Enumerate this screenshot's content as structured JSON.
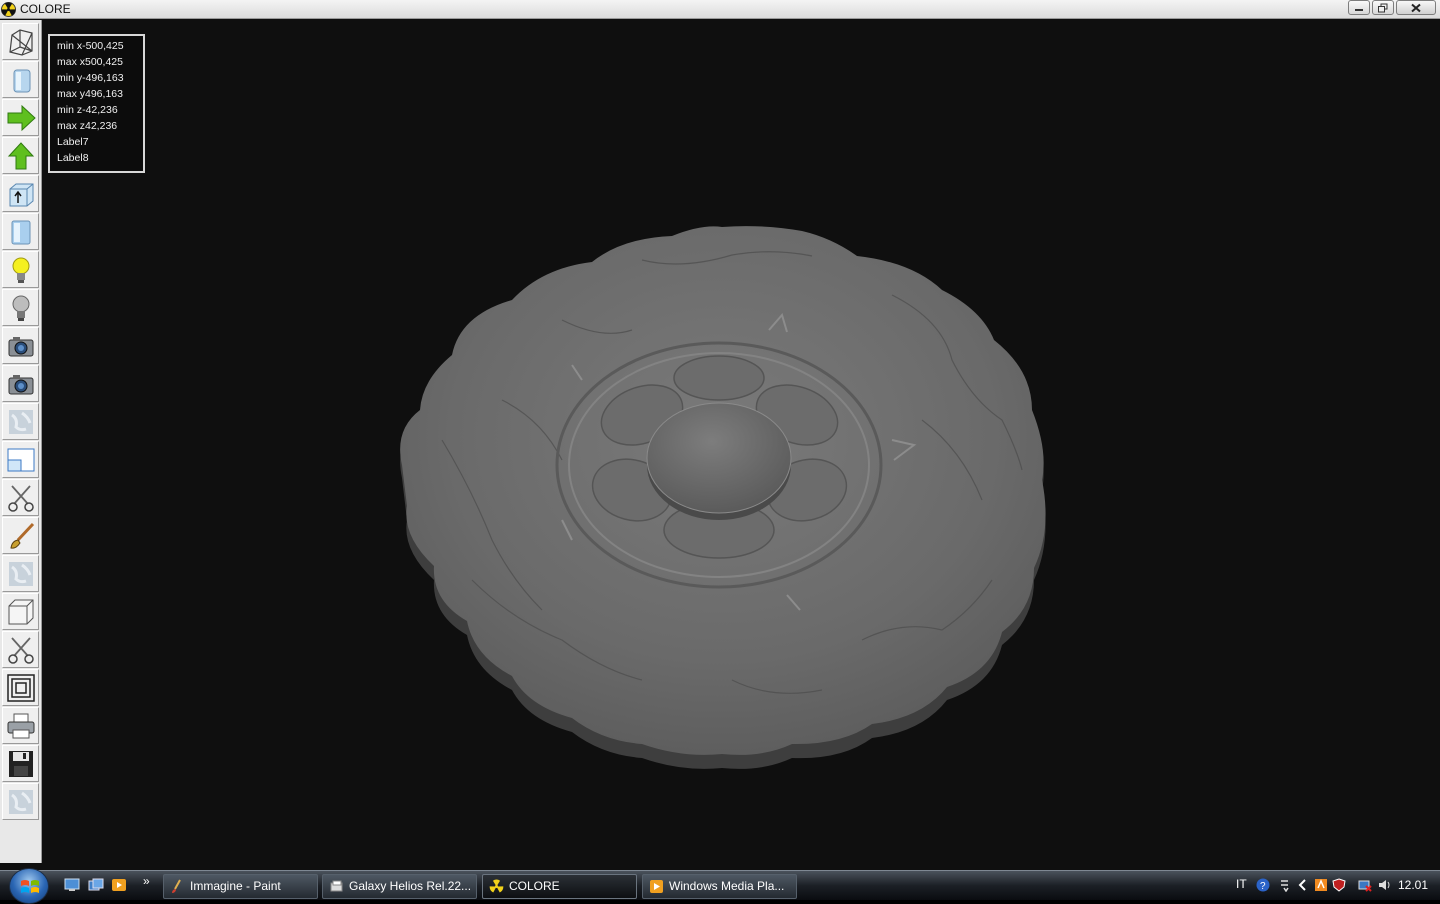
{
  "window": {
    "title": "COLORE",
    "controls": [
      "minimize",
      "restore",
      "close"
    ]
  },
  "toolbar": {
    "tools": [
      {
        "name": "wireframe-icon"
      },
      {
        "name": "solid-view-icon"
      },
      {
        "name": "arrow-right-icon"
      },
      {
        "name": "arrow-up-icon"
      },
      {
        "name": "box-arrow-icon"
      },
      {
        "name": "cylinder-icon"
      },
      {
        "name": "light-on-icon"
      },
      {
        "name": "light-off-icon"
      },
      {
        "name": "camera-icon"
      },
      {
        "name": "camera-icon"
      },
      {
        "name": "texture-icon"
      },
      {
        "name": "window-icon"
      },
      {
        "name": "scissors-icon"
      },
      {
        "name": "brush-icon"
      },
      {
        "name": "texture-icon"
      },
      {
        "name": "cube-icon"
      },
      {
        "name": "scissors-icon"
      },
      {
        "name": "concentric-squares-icon"
      },
      {
        "name": "printer-icon"
      },
      {
        "name": "save-icon"
      },
      {
        "name": "texture-icon"
      }
    ]
  },
  "info_panel": {
    "lines": [
      "min x-500,425",
      "max x500,425",
      "min y-496,163",
      "max y496,163",
      "min z-42,236",
      "max z42,236",
      "Label7",
      "Label8"
    ]
  },
  "taskbar": {
    "start_label": "Start",
    "quick_launch": [
      "show-desktop-icon",
      "switch-windows-icon",
      "media-player-icon"
    ],
    "more_label": "»",
    "buttons": [
      {
        "label": "Immagine - Paint",
        "icon": "paint-icon"
      },
      {
        "label": "Galaxy Helios  Rel.22...",
        "icon": "folder-icon"
      },
      {
        "label": "COLORE",
        "icon": "radiation-icon",
        "active": true
      },
      {
        "label": "Windows Media Pla...",
        "icon": "media-player-icon"
      }
    ],
    "tray": {
      "language": "IT",
      "clock": "12.01"
    }
  }
}
